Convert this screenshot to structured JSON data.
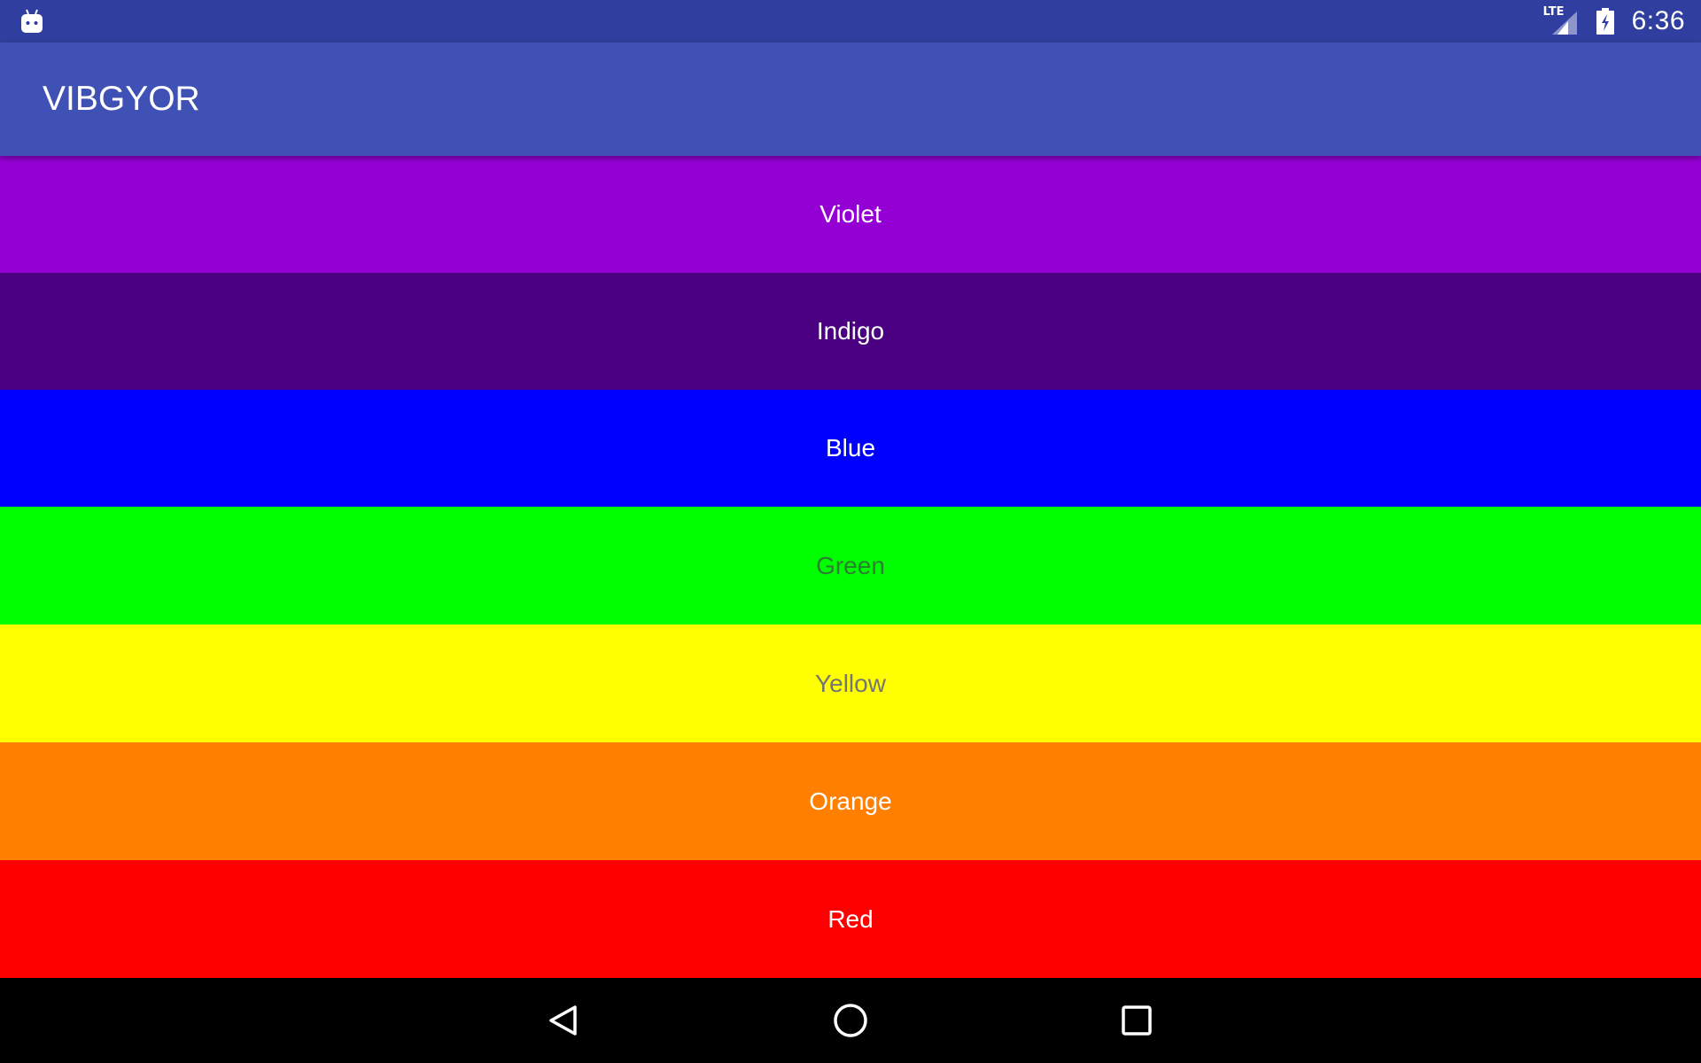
{
  "status_bar": {
    "network": "LTE",
    "time": "6:36",
    "background": "#303F9F"
  },
  "app_bar": {
    "title": "VIBGYOR",
    "background": "#3F51B5"
  },
  "colors": [
    {
      "label": "Violet",
      "background": "#9400D3",
      "text_color": "#FFFFFF"
    },
    {
      "label": "Indigo",
      "background": "#4B0082",
      "text_color": "#FFFFFF"
    },
    {
      "label": "Blue",
      "background": "#0000FF",
      "text_color": "#FFFFFF"
    },
    {
      "label": "Green",
      "background": "#00FF00",
      "text_color": "#2E7D32"
    },
    {
      "label": "Yellow",
      "background": "#FFFF00",
      "text_color": "#757575"
    },
    {
      "label": "Orange",
      "background": "#FF7F00",
      "text_color": "#FFFFFF"
    },
    {
      "label": "Red",
      "background": "#FF0000",
      "text_color": "#FFFFFF"
    }
  ],
  "nav_bar": {
    "icons": [
      "back-icon",
      "home-icon",
      "recents-icon"
    ]
  }
}
